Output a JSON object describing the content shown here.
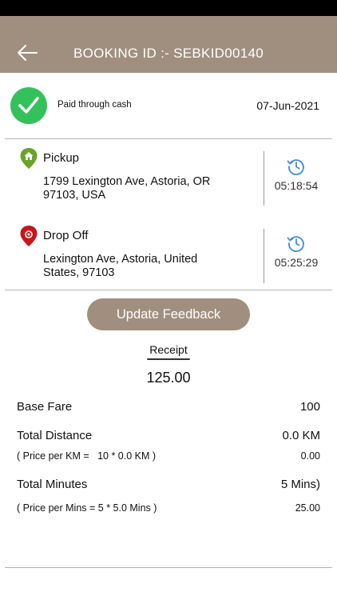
{
  "header": {
    "title": "BOOKING ID :- SEBKID00140",
    "back_icon": "back-arrow-icon",
    "background": "#a08f7f"
  },
  "payment": {
    "status_text": "Paid through cash",
    "date": "07-Jun-2021",
    "icon": "check-circle-icon",
    "icon_color": "#34c15b"
  },
  "pickup": {
    "title": "Pickup",
    "address_line1": "1799 Lexington Ave, Astoria, OR",
    "address_line2": "97103, USA",
    "time": "05:18:54",
    "icon": "pickup-pin-icon",
    "icon_color": "#6aa329"
  },
  "dropoff": {
    "title": "Drop Off",
    "address_line1": "Lexington Ave, Astoria, United",
    "address_line2": "States, 97103",
    "time": "05:25:29",
    "icon": "dropoff-pin-icon",
    "icon_color": "#c8141b"
  },
  "feedback_button": {
    "label": "Update Feedback"
  },
  "receipt": {
    "label": "Receipt",
    "total": "125.00",
    "base_fare_label": "Base Fare",
    "base_fare_value": "100",
    "distance_label": "Total Distance",
    "distance_value": "0.0 KM",
    "distance_detail": "( Price per KM =   10 * 0.0 KM )",
    "distance_detail_value": "0.00",
    "minutes_label": "Total Minutes",
    "minutes_value": "5 Mins)",
    "minutes_detail": "( Price per Mins = 5 * 5.0 Mins )",
    "minutes_detail_value": "25.00"
  }
}
